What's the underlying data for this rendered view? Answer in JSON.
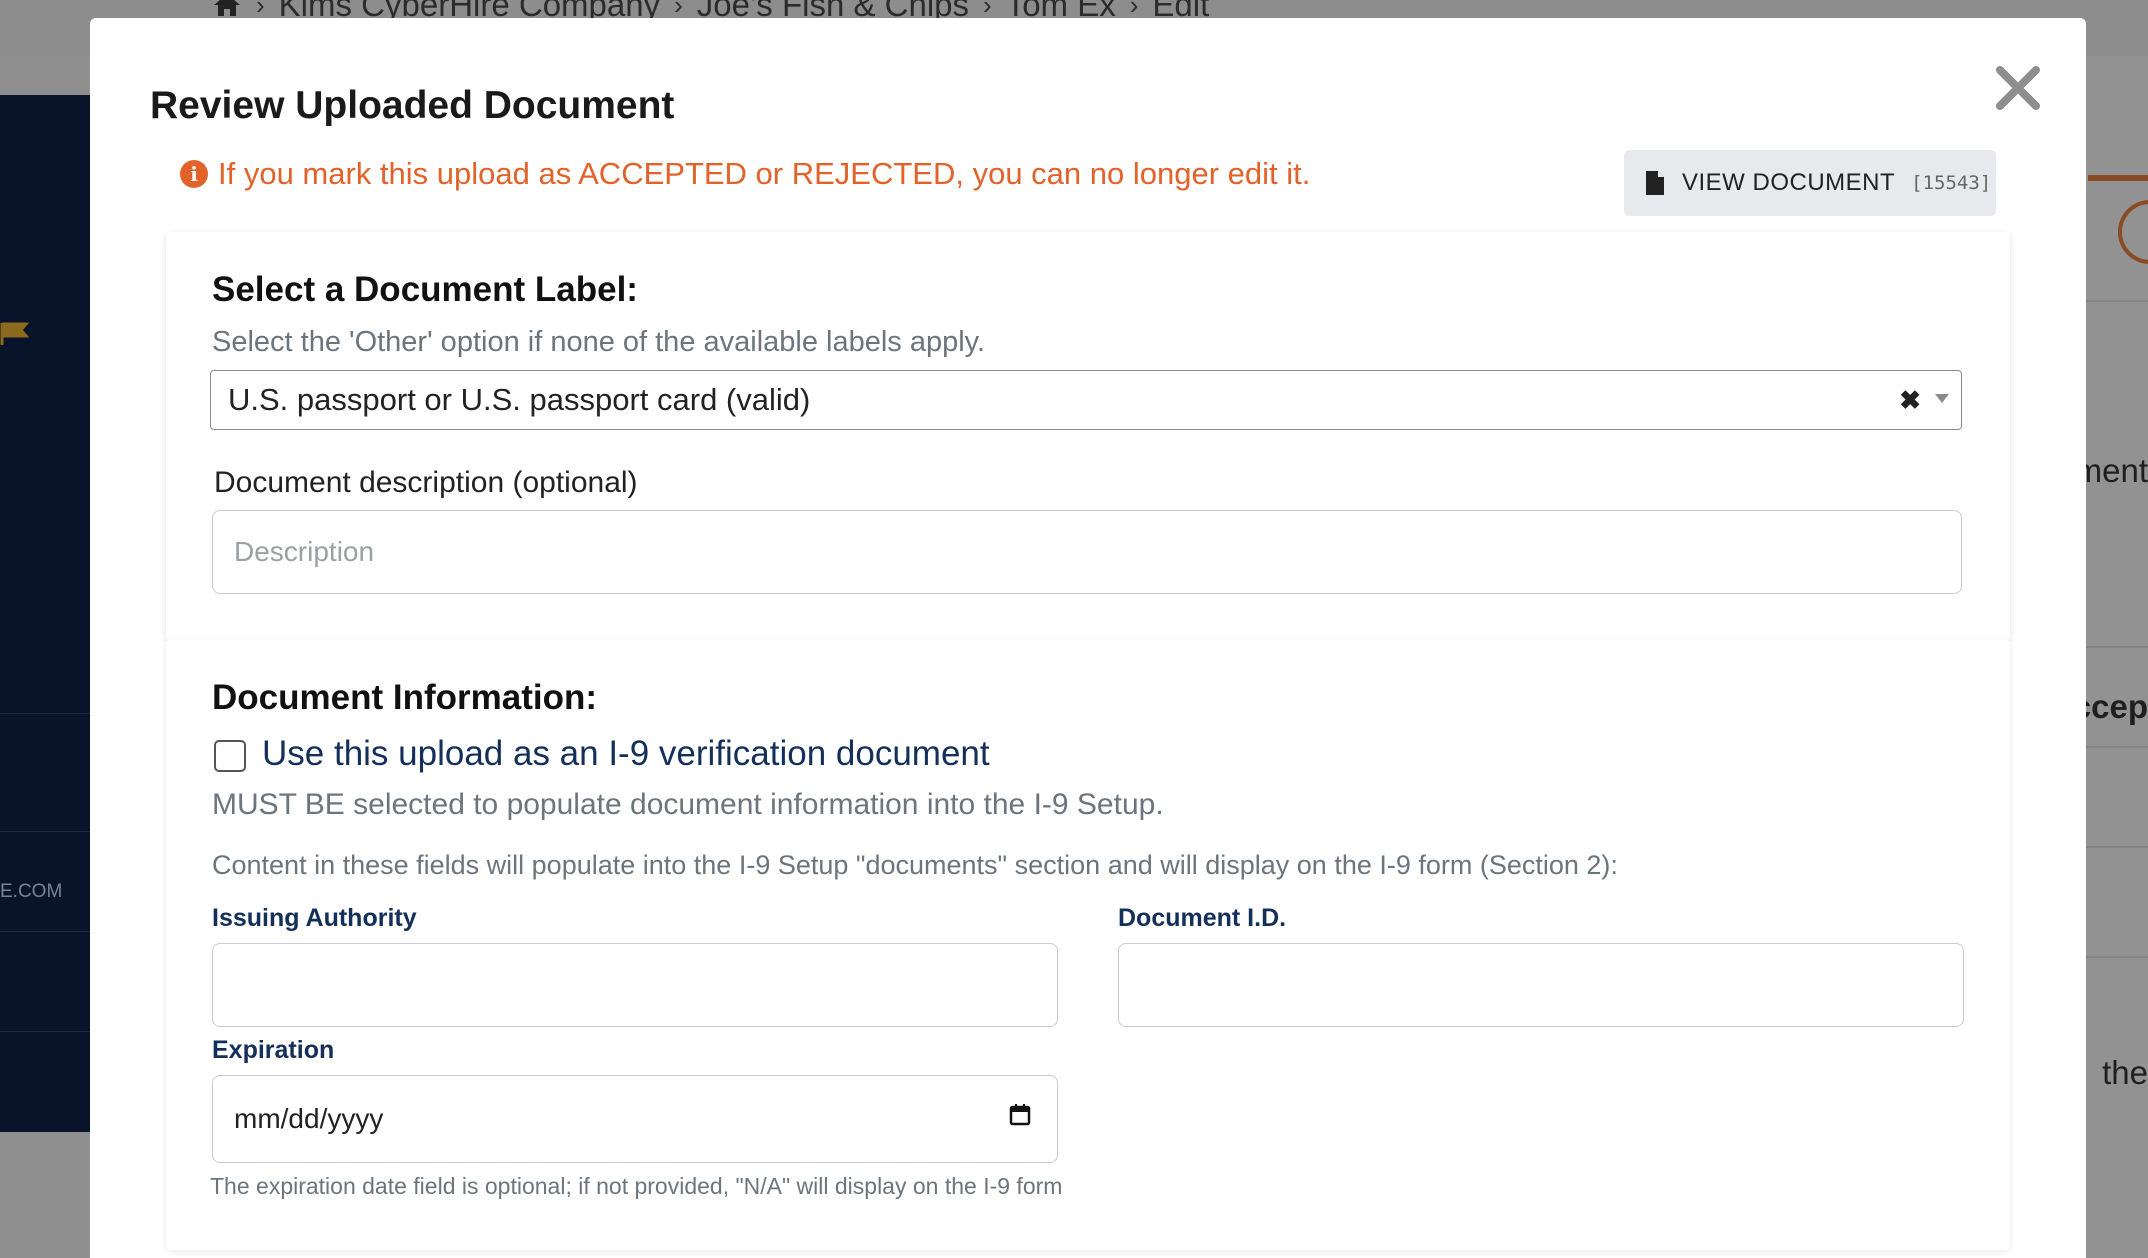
{
  "background": {
    "breadcrumbs": [
      "Kims CyberHire Company",
      "Joe's Fish & Chips",
      "Tom Ex",
      "Edit"
    ],
    "sidebar_text": "E.COM",
    "right_fragments": [
      "ment",
      "ccep",
      "the"
    ]
  },
  "modal": {
    "title": "Review Uploaded Document",
    "warning": "If you mark this upload as ACCEPTED or REJECTED, you can no longer edit it.",
    "view_button": {
      "label": "VIEW DOCUMENT",
      "count": "[15543]"
    },
    "label_section": {
      "heading": "Select a Document Label:",
      "help": "Select the 'Other' option if none of the available labels apply.",
      "selected_value": "U.S. passport or U.S. passport card (valid)",
      "description_label": "Document description (optional)",
      "description_placeholder": "Description"
    },
    "info_section": {
      "heading": "Document Information:",
      "checkbox_label": "Use this upload as an I-9 verification document",
      "must_note": "MUST BE selected to populate document information into the I-9 Setup.",
      "content_note": "Content in these fields will populate into the I-9 Setup \"documents\" section and will display on the I-9 form (Section 2):",
      "issuing_authority_label": "Issuing Authority",
      "document_id_label": "Document I.D.",
      "expiration_label": "Expiration",
      "expiration_placeholder": "mm/dd/yyyy",
      "expiration_help": "The expiration date field is optional; if not provided, \"N/A\" will display on the I-9 form"
    }
  }
}
